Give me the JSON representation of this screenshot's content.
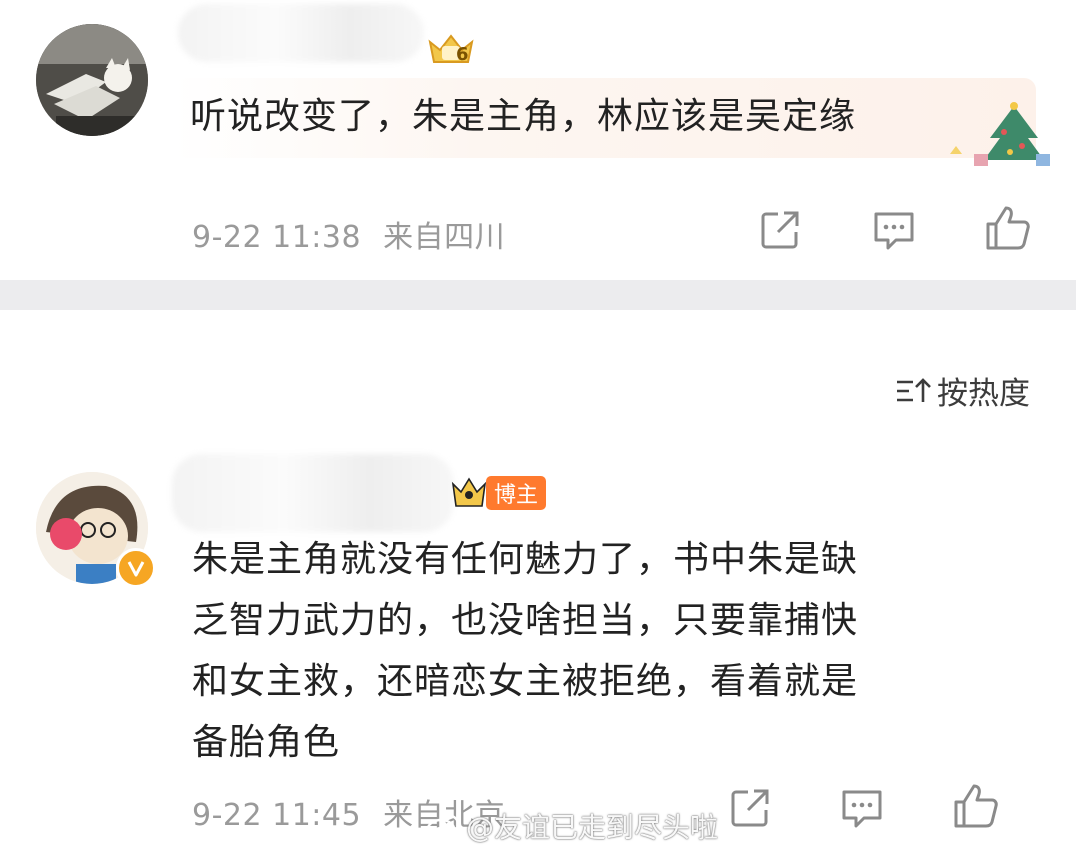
{
  "comment1": {
    "text": "听说改变了，朱是主角，林应该是吴定缘",
    "timestamp": "9-22 11:38",
    "location": "来自四川",
    "fan_badge_level": "6"
  },
  "sort": {
    "label": "按热度",
    "icon": "sort-icon"
  },
  "comment2": {
    "badge": "博主",
    "text_lines": [
      "朱是主角就没有任何魅力了，书中朱是缺",
      "乏智力武力的，也没啥担当，只要靠捕快",
      "和女主救，还暗恋女主被拒绝，看着就是",
      "备胎角色"
    ],
    "timestamp": "9-22 11:45",
    "location": "来自北京"
  },
  "watermark": {
    "text": "@友谊已走到尽头啦"
  },
  "icons": [
    "share-icon",
    "comment-icon",
    "like-icon",
    "verified-v-icon",
    "crown-icon"
  ],
  "colors": {
    "meta_gray": "#9a9a9a",
    "badge_orange": "#ff7a2e",
    "divider": "#ececee"
  }
}
